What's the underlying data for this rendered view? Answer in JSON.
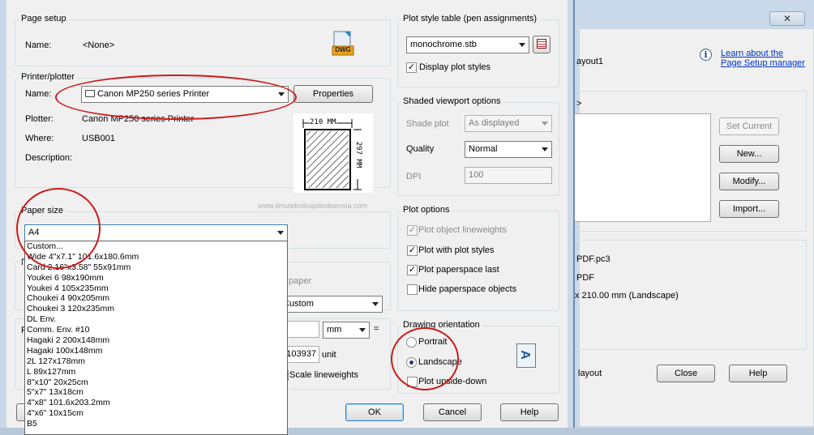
{
  "back_dialog": {
    "close_glyph": "✕",
    "learn_link_line1": "Learn about the",
    "learn_link_line2": "Page Setup manager",
    "layout_name_fragment": "ayout1",
    "list_fragment": ">",
    "set_current": "Set Current",
    "new": "New...",
    "modify": "Modify...",
    "import": "Import...",
    "detail_1": "PDF.pc3",
    "detail_2": "PDF",
    "detail_3": "x 210.00 mm (Landscape)",
    "checkbox_fragment": "layout",
    "close": "Close",
    "help": "Help"
  },
  "page_setup": {
    "title": "Page setup",
    "name_label": "Name:",
    "name_value": "<None>",
    "dwg_icon_text": "DWG"
  },
  "printer": {
    "title": "Printer/plotter",
    "name_label": "Name:",
    "selected_printer": "Canon MP250 series Printer",
    "properties": "Properties",
    "plotter_label": "Plotter:",
    "plotter_value": "Canon MP250 series Printer -",
    "where_label": "Where:",
    "where_value": "USB001",
    "description_label": "Description:",
    "preview_width": "210 MM",
    "preview_height": "297 MM"
  },
  "watermark": "www.ilmutekniksipilindoensia.com",
  "paper_size": {
    "title": "Paper size",
    "selected": "A4",
    "options": [
      "Custom...",
      "Wide 4\"x7.1\" 101.6x180.6mm",
      "Card 2.16\"x3.58\" 55x91mm",
      "Youkei 6 98x190mm",
      "Youkei 4 105x235mm",
      "Choukei 4 90x205mm",
      "Choukei 3 120x235mm",
      "DL Env.",
      "Comm. Env. #10",
      "Hagaki 2 200x148mm",
      "Hagaki 100x148mm",
      "2L 127x178mm",
      "L 89x127mm",
      "8\"x10\" 20x25cm",
      "5\"x7\" 13x18cm",
      "4\"x8\" 101.6x203.2mm",
      "4\"x6\" 10x15cm",
      "B5"
    ]
  },
  "hidden_fragments": {
    "paper_text": "paper",
    "custom_combo": "Custom",
    "unit_combo": "mm",
    "equals": "=",
    "scale_value": "103937",
    "unit_label": "unit",
    "scale_lineweights": "Scale lineweights",
    "letter_p1": "P",
    "letter_p2": "P"
  },
  "plot_style_table": {
    "title": "Plot style table (pen assignments)",
    "selected": "monochrome.stb",
    "display_plot_styles": "Display plot styles"
  },
  "shaded_viewport": {
    "title": "Shaded viewport options",
    "shade_plot_label": "Shade plot",
    "shade_plot_value": "As displayed",
    "quality_label": "Quality",
    "quality_value": "Normal",
    "dpi_label": "DPI",
    "dpi_value": "100"
  },
  "plot_options": {
    "title": "Plot options",
    "items": [
      {
        "label": "Plot object lineweights",
        "checked": "✓",
        "disabled": true
      },
      {
        "label": "Plot with plot styles",
        "checked": "✓",
        "disabled": false
      },
      {
        "label": "Plot paperspace last",
        "checked": "✓",
        "disabled": false
      },
      {
        "label": "Hide paperspace objects",
        "checked": "",
        "disabled": false
      }
    ]
  },
  "drawing_orientation": {
    "title": "Drawing orientation",
    "portrait": "Portrait",
    "landscape": "Landscape",
    "upside_down": "Plot upside-down",
    "selected": "Landscape",
    "icon_letter": "A"
  },
  "footer": {
    "ok": "OK",
    "cancel": "Cancel",
    "help": "Help"
  },
  "colors": {
    "annotation_red": "#cc1b1b",
    "dialog_bg": "#f0f0f0",
    "link_blue": "#0033cc"
  }
}
